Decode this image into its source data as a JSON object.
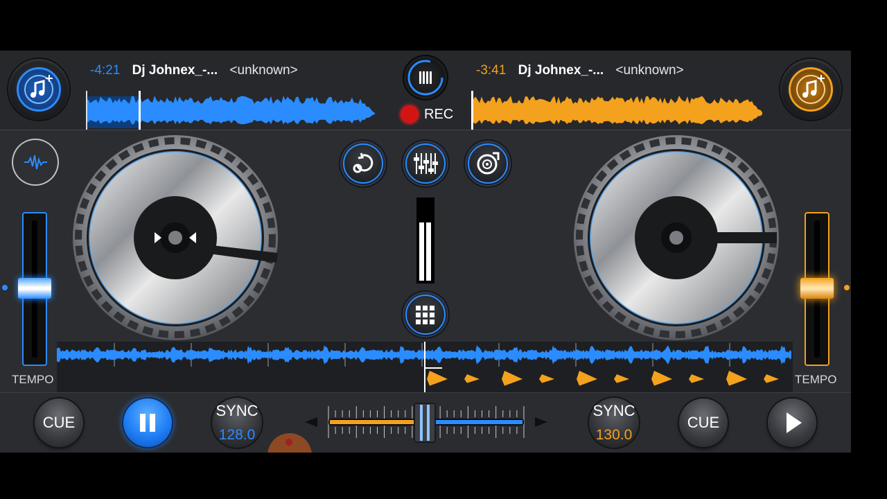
{
  "deck_left": {
    "time_remaining": "-4:21",
    "track_title": "Dj Johnex_-...",
    "artist": "<unknown>",
    "accent_color": "#2a8cff",
    "add_track_icon": "music-note-plus-icon"
  },
  "deck_right": {
    "time_remaining": "-3:41",
    "track_title": "Dj Johnex_-...",
    "artist": "<unknown>",
    "accent_color": "#f4a11d",
    "add_track_icon": "music-note-plus-icon"
  },
  "center": {
    "rec_label": "REC",
    "rec_color": "#d41414",
    "buttons": [
      "loop-icon",
      "mixer-eq-icon",
      "vinyl-fx-icon",
      "sampler-grid-icon"
    ]
  },
  "tempo_left": {
    "label": "TEMPO"
  },
  "tempo_right": {
    "label": "TEMPO"
  },
  "bottom_left": {
    "cue_label": "CUE",
    "play_state": "pause",
    "sync_label": "SYNC",
    "bpm": "128.0"
  },
  "bottom_right": {
    "cue_label": "CUE",
    "play_state": "play",
    "sync_label": "SYNC",
    "bpm": "130.0"
  },
  "crossfader": {
    "position": 0.5
  }
}
